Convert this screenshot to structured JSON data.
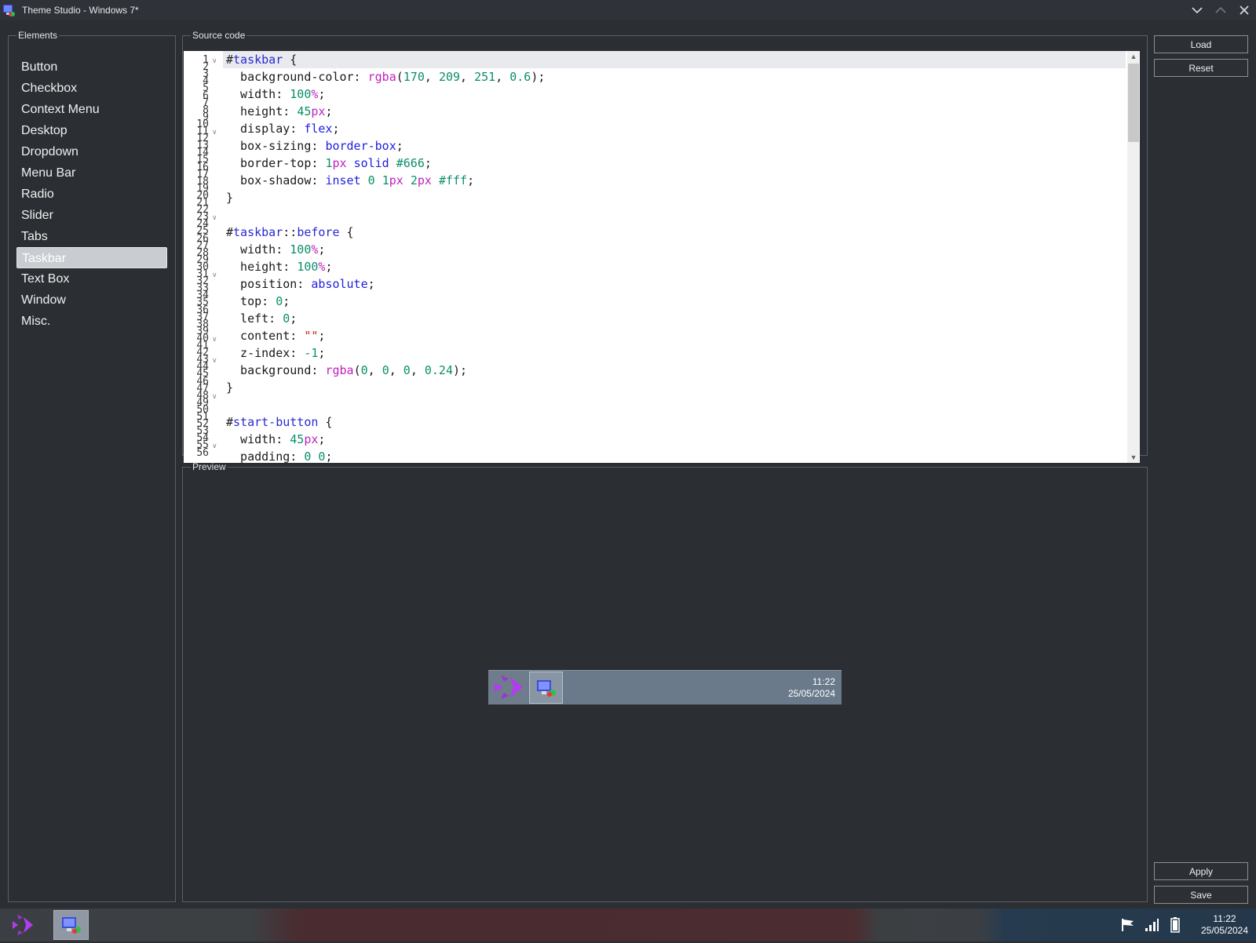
{
  "window": {
    "title": "Theme Studio - Windows 7*"
  },
  "panels": {
    "elements": "Elements",
    "source": "Source code",
    "preview": "Preview"
  },
  "elements": [
    {
      "label": "Button"
    },
    {
      "label": "Checkbox"
    },
    {
      "label": "Context Menu"
    },
    {
      "label": "Desktop"
    },
    {
      "label": "Dropdown"
    },
    {
      "label": "Menu Bar"
    },
    {
      "label": "Radio"
    },
    {
      "label": "Slider"
    },
    {
      "label": "Tabs"
    },
    {
      "label": "Taskbar"
    },
    {
      "label": "Text Box"
    },
    {
      "label": "Window"
    },
    {
      "label": "Misc."
    }
  ],
  "selected_element": "Taskbar",
  "buttons": {
    "load": "Load",
    "reset": "Reset",
    "apply": "Apply",
    "save": "Save"
  },
  "code_lines": [
    "#taskbar {",
    "  background-color: rgba(170, 209, 251, 0.6);",
    "  width: 100%;",
    "  height: 45px;",
    "  display: flex;",
    "  box-sizing: border-box;",
    "  border-top: 1px solid #666;",
    "  box-shadow: inset 0 1px 2px #fff;",
    "}",
    "",
    "#taskbar::before {",
    "  width: 100%;",
    "  height: 100%;",
    "  position: absolute;",
    "  top: 0;",
    "  left: 0;",
    "  content: \"\";",
    "  z-index: -1;",
    "  background: rgba(0, 0, 0, 0.24);",
    "}",
    "",
    "#start-button {",
    "  width: 45px;",
    "  padding: 0 0;"
  ],
  "line_numbers": [
    "1",
    "2",
    "3",
    "4",
    "5",
    "6",
    "7",
    "8",
    "9",
    "10",
    "11",
    "12",
    "13",
    "14",
    "15",
    "16",
    "17",
    "18",
    "19",
    "20",
    "21",
    "22",
    "23",
    "24",
    "25",
    "26",
    "27",
    "28",
    "29",
    "30",
    "31",
    "32",
    "33",
    "34",
    "35",
    "36",
    "37",
    "38",
    "39",
    "40",
    "41",
    "42",
    "43",
    "44",
    "45",
    "46",
    "47",
    "48",
    "49",
    "50",
    "51",
    "52",
    "53",
    "54",
    "55",
    "56"
  ],
  "preview_taskbar": {
    "time": "11:22",
    "date": "25/05/2024"
  },
  "os_taskbar": {
    "time": "11:22",
    "date": "25/05/2024"
  },
  "icons": {
    "app": "computer-monitor-icon",
    "start": "arrows-start-icon",
    "tray": [
      "flag-icon",
      "signal-icon",
      "battery-icon"
    ]
  },
  "colors": {
    "background": "#2b2e33",
    "selection": "#c9ccd0",
    "editor_bg": "#ffffff",
    "preview_taskbar": "#6b7a8b",
    "start_accent": "#b23cf0"
  }
}
